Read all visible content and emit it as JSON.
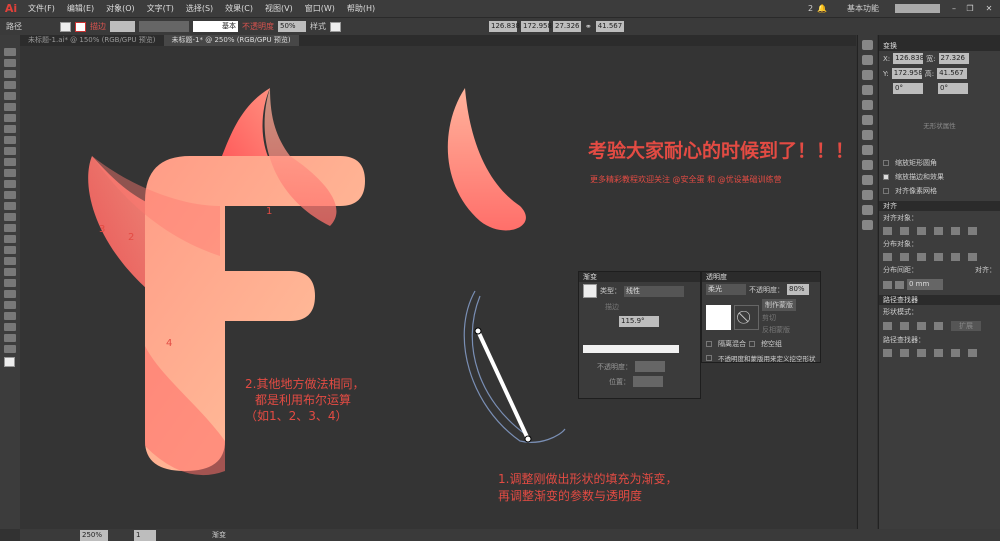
{
  "app": {
    "logo": "Ai",
    "menus": [
      "文件(F)",
      "编辑(E)",
      "对象(O)",
      "文字(T)",
      "选择(S)",
      "效果(C)",
      "视图(V)",
      "窗口(W)",
      "帮助(H)"
    ],
    "workspace": "基本功能",
    "notifications": "2"
  },
  "control": {
    "selection": "路径",
    "stroke_label": "描边",
    "stroke_style": "基本",
    "opacity_label": "不透明度",
    "opacity": "50%",
    "style_label": "样式",
    "x": "126.838",
    "y": "172.958",
    "w": "27.326",
    "h": "41.567"
  },
  "tabs": [
    {
      "label": "未标题-1.ai* @ 150% (RGB/GPU 预览)"
    },
    {
      "label": "未标题-1* @ 250% (RGB/GPU 预览)"
    }
  ],
  "transform": {
    "title": "变换",
    "x_label": "X:",
    "x": "126.838",
    "y_label": "Y:",
    "y": "172.958",
    "w_label": "宽:",
    "w": "27.326",
    "h_label": "高:",
    "h": "41.567",
    "rotate": "0°",
    "shear": "0°",
    "no_shape": "无形状属性",
    "opt1": "缩放矩形圆角",
    "opt2": "缩放描边和效果",
    "opt3": "对齐像素网格"
  },
  "align": {
    "title": "对齐",
    "align_objects": "对齐对象：",
    "distribute_objects": "分布对象：",
    "distribute_spacing": "分布间距：",
    "align_to": "对齐：",
    "spacing": "0 mm"
  },
  "pathfinder": {
    "title": "路径查找器",
    "shape_modes": "形状模式：",
    "expand": "扩展",
    "pathfinders": "路径查找器："
  },
  "gradient": {
    "title": "渐变",
    "type_label": "类型：",
    "type": "线性",
    "stroke_label": "描边",
    "angle": "115.9°",
    "opacity_label": "不透明度：",
    "position_label": "位置："
  },
  "transparency": {
    "title": "透明度",
    "mode": "柔光",
    "opacity_label": "不透明度：",
    "opacity": "80%",
    "make_mask": "制作蒙版",
    "clip": "剪切",
    "invert": "反相蒙版",
    "isolate": "隔离混合",
    "knockout": "挖空组",
    "opacity_mask": "不透明度和蒙版用来定义挖空形状"
  },
  "annotations": {
    "headline": "考验大家耐心的时候到了！！！",
    "sub": "更多精彩教程欢迎关注 @安全蛋 和 @优设基础训练营",
    "note2_l1": "2.其他地方做法相同，",
    "note2_l2": "都是利用布尔运算",
    "note2_l3": "（如1、2、3、4）",
    "note1_l1": "1.调整刚做出形状的填充为渐变，",
    "note1_l2": "再调整渐变的参数与透明度",
    "n1": "1",
    "n2": "2",
    "n3": "3",
    "n4": "4"
  },
  "status": {
    "zoom": "250%",
    "page": "1",
    "tool": "渐变"
  },
  "colors": {
    "accent": "#e34b43",
    "grad_start": "#ff8a7a",
    "grad_end": "#ffc39a"
  }
}
